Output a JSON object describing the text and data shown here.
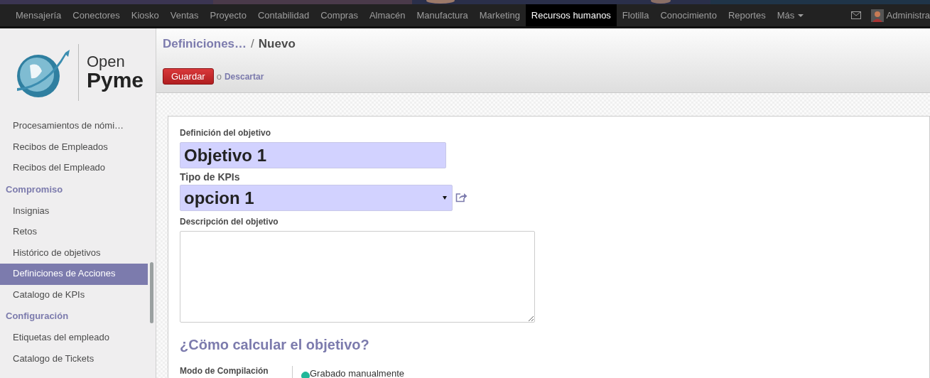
{
  "navbar": {
    "items": [
      {
        "label": "Mensajería",
        "selected": false
      },
      {
        "label": "Conectores",
        "selected": false
      },
      {
        "label": "Kiosko",
        "selected": false
      },
      {
        "label": "Ventas",
        "selected": false
      },
      {
        "label": "Proyecto",
        "selected": false
      },
      {
        "label": "Contabilidad",
        "selected": false
      },
      {
        "label": "Compras",
        "selected": false
      },
      {
        "label": "Almacén",
        "selected": false
      },
      {
        "label": "Manufactura",
        "selected": false
      },
      {
        "label": "Marketing",
        "selected": false
      },
      {
        "label": "Recursos humanos",
        "selected": true
      },
      {
        "label": "Flotilla",
        "selected": false
      },
      {
        "label": "Conocimiento",
        "selected": false
      },
      {
        "label": "Reportes",
        "selected": false
      }
    ],
    "more": "Más",
    "user": "Administra"
  },
  "logo": {
    "line1": "Open",
    "line2": "Pyme"
  },
  "sidebar": {
    "items": [
      {
        "kind": "item",
        "label": "Procesamientos de nómi…",
        "selected": false
      },
      {
        "kind": "item",
        "label": "Recibos de Empleados",
        "selected": false
      },
      {
        "kind": "item",
        "label": "Recibos del Empleado",
        "selected": false
      },
      {
        "kind": "heading",
        "label": "Compromiso"
      },
      {
        "kind": "item",
        "label": "Insignias",
        "selected": false
      },
      {
        "kind": "item",
        "label": "Retos",
        "selected": false
      },
      {
        "kind": "item",
        "label": "Histórico de objetivos",
        "selected": false
      },
      {
        "kind": "item",
        "label": "Definiciones de Acciones",
        "selected": true
      },
      {
        "kind": "item",
        "label": "Catalogo de KPIs",
        "selected": false
      },
      {
        "kind": "heading",
        "label": "Configuración"
      },
      {
        "kind": "item",
        "label": "Etiquetas del empleado",
        "selected": false
      },
      {
        "kind": "item",
        "label": "Catalogo de Tickets",
        "selected": false
      }
    ]
  },
  "breadcrumb": {
    "parent": "Definiciones…",
    "separator": "/",
    "current": "Nuevo"
  },
  "actions": {
    "save": "Guardar",
    "or": "o",
    "discard": "Descartar"
  },
  "form": {
    "name_label": "Definición del objetivo",
    "name_value": "Objetivo 1",
    "kpi_label": "Tipo de KPIs",
    "kpi_value": "opcion 1",
    "description_label": "Descripción del objetivo",
    "section_title": "¿Cömo calcular el objetivo?",
    "compile_mode": {
      "label": "Modo de Compilación",
      "options": [
        {
          "label": "Grabado manualmente",
          "selected": true
        }
      ]
    }
  }
}
